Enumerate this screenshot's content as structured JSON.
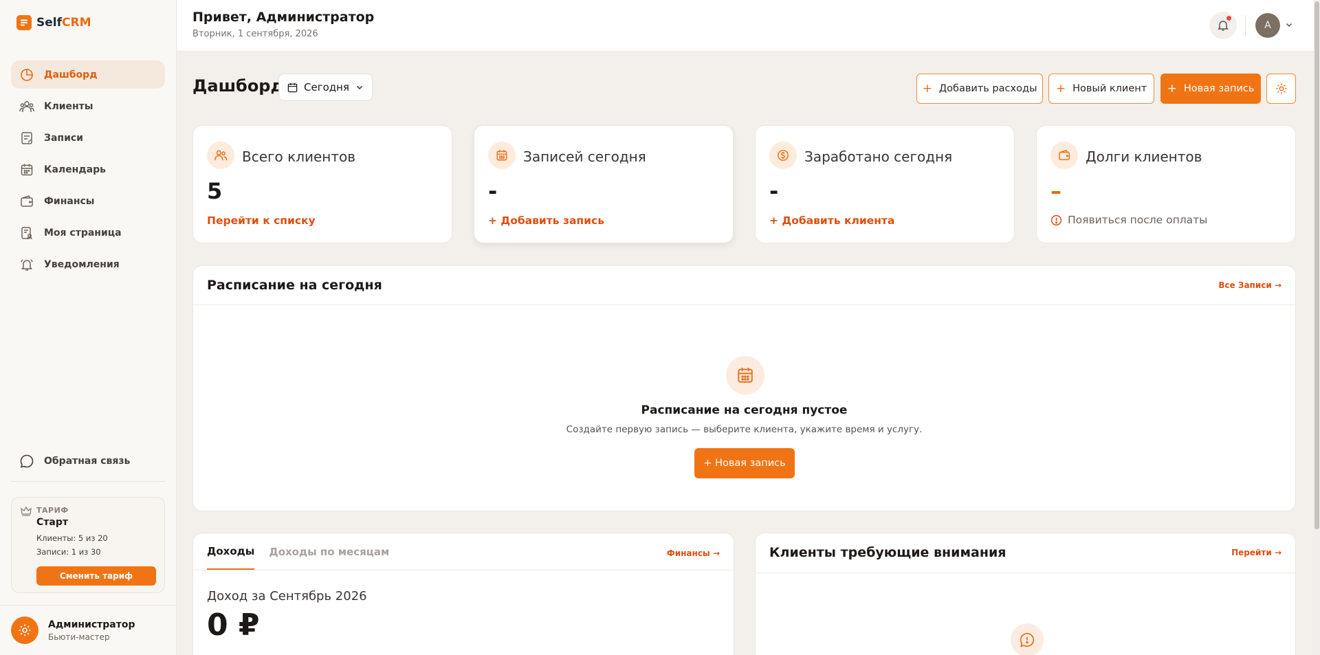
{
  "brand": {
    "name_main": "Self",
    "name_accent": "CRM"
  },
  "sidebar": {
    "items": [
      {
        "label": "Дашборд",
        "icon": "dashboard-icon",
        "active": true
      },
      {
        "label": "Клиенты",
        "icon": "users-icon"
      },
      {
        "label": "Записи",
        "icon": "notes-icon"
      },
      {
        "label": "Календарь",
        "icon": "calendar-icon"
      },
      {
        "label": "Финансы",
        "icon": "wallet-icon"
      },
      {
        "label": "Моя страница",
        "icon": "profile-page-icon"
      },
      {
        "label": "Уведомления",
        "icon": "bell-icon"
      }
    ],
    "feedback": "Обратная связь",
    "plan": {
      "kicker": "ТАРИФ",
      "name": "Старт",
      "clients": "Клиенты: 5 из 20",
      "records": "Записи: 1 из 30",
      "button": "Сменить тариф"
    },
    "user": {
      "name": "Администратор",
      "role": "Бьюти-мастер"
    }
  },
  "header": {
    "greeting": "Привет, Администратор",
    "date": "Вторник, 1 сентября, 2026",
    "avatar_letter": "A"
  },
  "main": {
    "title": "Дашборд",
    "period": "Сегодня",
    "actions": {
      "add_expense": "Добавить расходы",
      "new_client": "Новый клиент",
      "new_record": "Новая запись"
    },
    "cards": {
      "clients": {
        "title": "Всего клиентов",
        "value": "5",
        "link": "Перейти к списку"
      },
      "records": {
        "title": "Записей сегодня",
        "value": "-",
        "link": "+ Добавить запись"
      },
      "earned": {
        "title": "Заработано сегодня",
        "value": "-",
        "link": "+ Добавить клиента"
      },
      "debts": {
        "title": "Долги клиентов",
        "value": "–",
        "note": "Появиться после оплаты"
      }
    },
    "schedule": {
      "title": "Расписание на сегодня",
      "link": "Все Записи →",
      "empty_title": "Расписание на сегодня пустое",
      "empty_text": "Создайте первую запись — выберите клиента, укажите время и услугу.",
      "empty_button": "+ Новая запись"
    },
    "income": {
      "tabs": [
        "Доходы",
        "Доходы по месяцам"
      ],
      "link": "Финансы →",
      "label": "Доход за Сентябрь 2026",
      "value": "0 ₽"
    },
    "attention": {
      "title": "Клиенты требующие внимания",
      "link": "Перейти →"
    }
  },
  "colors": {
    "accent": "#f07414",
    "link": "#dd4f0f",
    "background": "#f3f0eb"
  }
}
